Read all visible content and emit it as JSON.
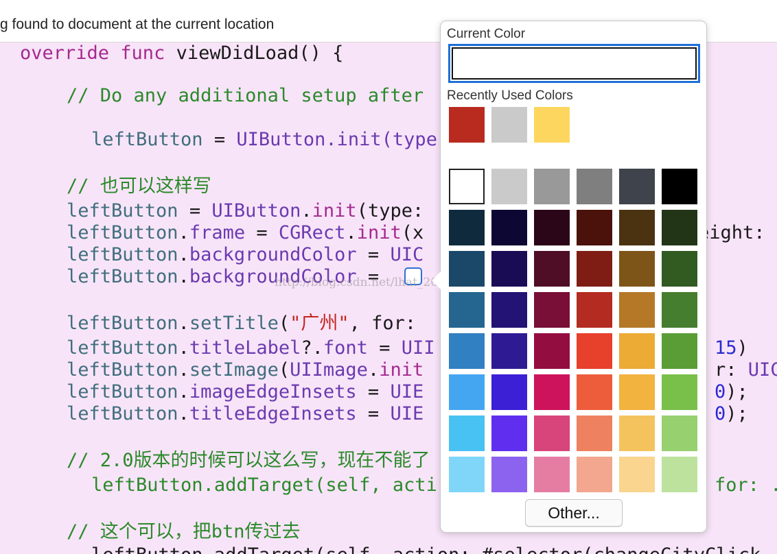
{
  "topbar": {
    "message": "g found to document at the current location"
  },
  "code": {
    "l1_kw": "override func",
    "l1_rest": " viewDidLoad() {",
    "l2_comment": "// Do any additional setup after",
    "l3_prop": "leftButton",
    "l3_mid": " = ",
    "l3_type": "UIButton",
    "l3_rest": ".init(type",
    "l4_comment": "// 也可以这样写",
    "l5_prop": "leftButton",
    "l5_mid": " = ",
    "l5_type": "UIButton",
    "l5_dot": ".",
    "l5_init": "init",
    "l5_rest": "(type:",
    "l6_prop": "leftButton",
    "l6_dot": ".",
    "l6_member": "frame",
    "l6_mid": " = ",
    "l6_type": "CGRect",
    "l6_dot2": ".",
    "l6_init": "init",
    "l6_rest": "(x",
    "l6_tail": "eight:",
    "l7_prop": "leftButton",
    "l7_dot": ".",
    "l7_member": "backgroundColor",
    "l7_mid": " = ",
    "l7_type": "UIC",
    "l8_prop": "leftButton",
    "l8_dot": ".",
    "l8_member": "backgroundColor",
    "l8_mid": " = ",
    "l9_prop": "leftButton",
    "l9_dot": ".",
    "l9_member": "setTitle",
    "l9_paren": "(",
    "l9_string": "\"广州\"",
    "l9_rest": ", for:",
    "l10_prop": "leftButton",
    "l10_dot": ".",
    "l10_member": "titleLabel",
    "l10_q": "?.",
    "l10_member2": "font",
    "l10_mid": " = ",
    "l10_type": "UII",
    "l10_num": "15",
    "l10_tail": ")",
    "l11_prop": "leftButton",
    "l11_dot": ".",
    "l11_member": "setImage",
    "l11_paren": "(",
    "l11_type": "UIImage",
    "l11_dot2": ".",
    "l11_init": "init",
    "l11_tail": "r:",
    "l11_tail_type": " UICo",
    "l12_prop": "leftButton",
    "l12_dot": ".",
    "l12_member": "imageEdgeInsets",
    "l12_mid": " = ",
    "l12_type": "UIE",
    "l12_num": "0",
    "l12_tail": ");",
    "l13_prop": "leftButton",
    "l13_dot": ".",
    "l13_member": "titleEdgeInsets",
    "l13_mid": " = ",
    "l13_type": "UIE",
    "l13_num": "0",
    "l13_tail": ");",
    "l14_comment": "// 2.0版本的时候可以这么写，现在不能了",
    "l15_prop": "leftButton",
    "l15_rest": ".addTarget(self, acti",
    "l15_tail": "for: .",
    "l16_comment": "// 这个可以，把btn传过去",
    "l17_text": "leftButton.addTarget(self, action: #selector(changeCityClick"
  },
  "watermark": "http://blog.csdn.net/lhat_20037505",
  "picker": {
    "current_label": "Current Color",
    "recent_label": "Recently Used Colors",
    "recent": [
      "#b92b1f",
      "#cacaca",
      "#fdd65f"
    ],
    "grid": [
      [
        "#ffffff",
        "#cacaca",
        "#999999",
        "#7f7f7f",
        "#3f434b",
        "#000000"
      ],
      [
        "#0f2a3c",
        "#0d0733",
        "#2b0618",
        "#4a120a",
        "#4b3312",
        "#223617"
      ],
      [
        "#1b4869",
        "#1a0b55",
        "#4f0e25",
        "#7f1d14",
        "#7e5519",
        "#325b22"
      ],
      [
        "#24668f",
        "#221374",
        "#790f36",
        "#b32b21",
        "#b47826",
        "#457e2e"
      ],
      [
        "#3180c1",
        "#2e1b94",
        "#940d41",
        "#e7402b",
        "#ecab35",
        "#5a9d37"
      ],
      [
        "#44a6f1",
        "#3b20d6",
        "#cd135b",
        "#ed5d3c",
        "#f2b33f",
        "#79c04b"
      ],
      [
        "#48c1f3",
        "#5f2eee",
        "#d7457a",
        "#ee8160",
        "#f4c35d",
        "#97d06f"
      ],
      [
        "#7fd6f9",
        "#8c63ef",
        "#e57da3",
        "#f2a78e",
        "#f9d58f",
        "#bde29e"
      ]
    ],
    "other_label": "Other..."
  }
}
